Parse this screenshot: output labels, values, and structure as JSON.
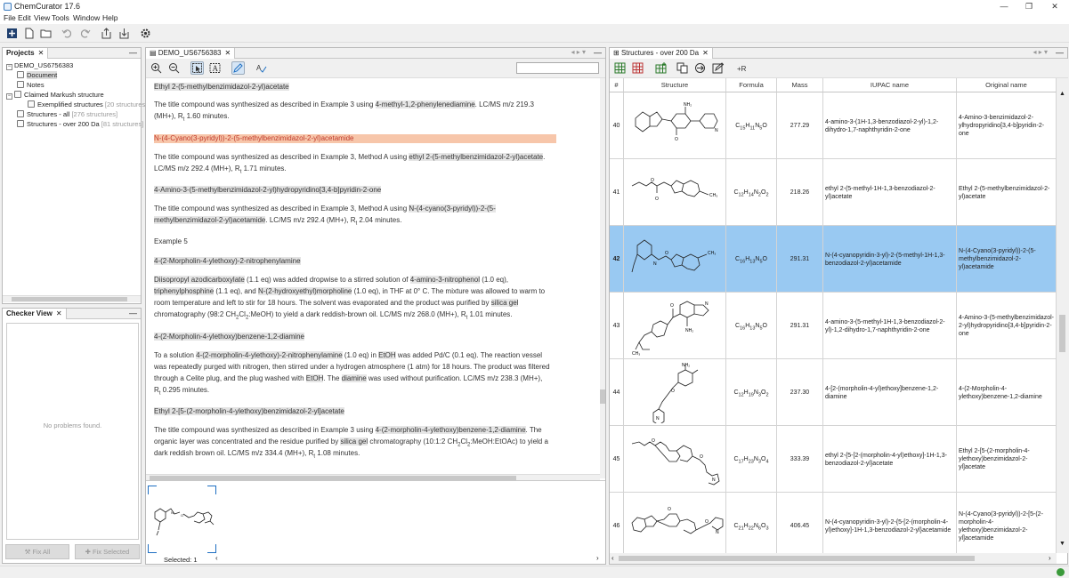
{
  "window": {
    "title": "ChemCurator 17.6"
  },
  "menu": [
    "File",
    "Edit",
    "View",
    "Tools",
    "Window",
    "Help"
  ],
  "projects": {
    "tab": "Projects",
    "tree": [
      {
        "label": "DEMO_US6756383",
        "count": ""
      },
      {
        "label": "Document",
        "count": ""
      },
      {
        "label": "Notes",
        "count": ""
      },
      {
        "label": "Claimed Markush structure",
        "count": ""
      },
      {
        "label": "Exemplified structures",
        "count": "[20 structures]"
      },
      {
        "label": "Structures - all",
        "count": "[276 structures]"
      },
      {
        "label": "Structures - over 200 Da",
        "count": "[81 structures]"
      }
    ]
  },
  "checker": {
    "tab": "Checker View",
    "empty": "No problems found.",
    "fix_all": "Fix All",
    "fix_selected": "Fix Selected"
  },
  "document": {
    "tab": "DEMO_US6756383",
    "selected": "Selected: 1",
    "lines": [
      {
        "t": "title",
        "s": [
          "Ethyl 2-(5-methylbenzimidazol-2-yl)acetate"
        ]
      },
      {
        "t": "text",
        "s": [
          "The title compound was synthesized as described in Example 3 using ",
          "4-methyl-1,2-phenylenediamine",
          ". LC/MS m/z 219.3"
        ]
      },
      {
        "t": "text",
        "s": [
          "(MH+), R",
          "t",
          " 1.60 minutes."
        ]
      },
      {
        "t": "red",
        "s": [
          "N-(4-Cyano(3-pyridyl))-2-(5-methylbenzimidazol-2-yl)acetamide"
        ]
      },
      {
        "t": "text",
        "s": [
          "The title compound was synthesized as described in Example 3, Method A using ",
          "ethyl 2-(5-methylbenzimidazol-2-yl)acetate",
          "."
        ]
      },
      {
        "t": "text",
        "s": [
          "LC/MS m/z 292.4 (MH+), R",
          "t",
          " 1.71 minutes."
        ]
      },
      {
        "t": "title",
        "s": [
          "4-Amino-3-(5-methylbenzimidazol-2-yl)hydropyridino[3,4-b]pyridin-2-one"
        ]
      },
      {
        "t": "text",
        "s": [
          "The title compound was synthesized as described in Example 3, Method A using ",
          "N-(4-cyano(3-pyridyl))-2-(5-"
        ]
      },
      {
        "t": "text",
        "s": [
          "methylbenzimidazol-2-yl)acetamide",
          ". LC/MS m/z 292.4 (MH+), R",
          "t",
          " 2.04 minutes."
        ]
      },
      {
        "t": "plain",
        "s": [
          "Example 5"
        ]
      },
      {
        "t": "title",
        "s": [
          "4-(2-Morpholin-4-ylethoxy)-2-nitrophenylamine"
        ]
      },
      {
        "t": "text",
        "s": [
          "Diisopropyl azodicarboxylate",
          " (1.1 eq) was added dropwise to a stirred solution of ",
          "4-amino-3-nitrophenol",
          " (1.0 eq),"
        ]
      },
      {
        "t": "text",
        "s": [
          "triphenylphosphine",
          " (1.1 eq), and ",
          "N-(2-hydroxyethyl)morpholine",
          " (1.0 eq), in THF at 0° C. The mixture was allowed to warm to"
        ]
      },
      {
        "t": "text",
        "s": [
          "room temperature and left to stir for 18 hours. The solvent was evaporated and the product was purified by ",
          "silica gel",
          ""
        ]
      },
      {
        "t": "text",
        "s": [
          "chromatography (98:2 CH",
          "2",
          "Cl",
          "2",
          ":MeOH) to yield a dark reddish-brown oil. LC/MS m/z 268.0 (MH+), R",
          "t",
          " 1.01 minutes."
        ]
      },
      {
        "t": "title",
        "s": [
          "4-(2-Morpholin-4-ylethoxy)benzene-1,2-diamine"
        ]
      },
      {
        "t": "text",
        "s": [
          "To a solution ",
          "4-(2-morpholin-4-ylethoxy)-2-nitrophenylamine",
          " (1.0 eq) in ",
          "EtOH",
          " was added Pd/C (0.1 eq). The reaction vessel"
        ]
      },
      {
        "t": "text",
        "s": [
          "was repeatedly purged with nitrogen, then stirred under a hydrogen atmosphere (1 atm) for 18 hours. The product was filtered"
        ]
      },
      {
        "t": "text",
        "s": [
          "through a Celite plug, and the plug washed with ",
          "EtOH",
          ". The ",
          "diamine",
          " was used without purification. LC/MS m/z 238.3 (MH+),"
        ]
      },
      {
        "t": "text",
        "s": [
          "R",
          "t",
          " 0.295 minutes."
        ]
      },
      {
        "t": "title",
        "s": [
          "Ethyl 2-[5-(2-morpholin-4-ylethoxy)benzimidazol-2-yl]acetate"
        ]
      },
      {
        "t": "text",
        "s": [
          "The title compound was synthesized as described in Example 3 using ",
          "4-(2-morpholin-4-ylethoxy)benzene-1,2-diamine",
          ". The"
        ]
      },
      {
        "t": "text",
        "s": [
          "organic layer was concentrated and the residue purified by ",
          "silica gel",
          " chromatography (10:1:2 CH",
          "2",
          "Cl",
          "2",
          ":MeOH:EtOAc) to yield a"
        ]
      },
      {
        "t": "text",
        "s": [
          "dark reddish brown oil. LC/MS m/z 334.4 (MH+), R",
          "t",
          " 1.08 minutes."
        ]
      }
    ]
  },
  "table": {
    "tab": "Structures - over 200 Da",
    "headers": [
      "#",
      "Structure",
      "Formula",
      "Mass",
      "IUPAC name",
      "Original name"
    ],
    "rows": [
      {
        "n": "40",
        "formula": "C15H11N5O",
        "mass": "277.29",
        "iupac": "4-amino-3-(1H-1,3-benzodiazol-2-yl)-1,2-dihydro-1,7-naphthyridin-2-one",
        "orig": "4-Amino-3-benzimidazol-2-ylhydropyridino[3,4-b]pyridin-2-one",
        "selected": false
      },
      {
        "n": "41",
        "formula": "C12H14N2O2",
        "mass": "218.26",
        "iupac": "ethyl 2-(5-methyl-1H-1,3-benzodiazol-2-yl)acetate",
        "orig": "Ethyl 2-(5-methylbenzimidazol-2-yl)acetate",
        "selected": false
      },
      {
        "n": "42",
        "formula": "C16H13N5O",
        "mass": "291.31",
        "iupac": "N-(4-cyanopyridin-3-yl)-2-(5-methyl-1H-1,3-benzodiazol-2-yl)acetamide",
        "orig": "N-(4-Cyano(3-pyridyl))-2-(5-methylbenzimidazol-2-yl)acetamide",
        "selected": true
      },
      {
        "n": "43",
        "formula": "C16H13N5O",
        "mass": "291.31",
        "iupac": "4-amino-3-(5-methyl-1H-1,3-benzodiazol-2-yl)-1,2-dihydro-1,7-naphthyridin-2-one",
        "orig": "4-Amino-3-(5-methylbenzimidazol-2-yl)hydropyridino[3,4-b]pyridin-2-one",
        "selected": false
      },
      {
        "n": "44",
        "formula": "C12H19N3O2",
        "mass": "237.30",
        "iupac": "4-[2-(morpholin-4-yl)ethoxy]benzene-1,2-diamine",
        "orig": "4-(2-Morpholin-4-ylethoxy)benzene-1,2-diamine",
        "selected": false
      },
      {
        "n": "45",
        "formula": "C17H23N3O4",
        "mass": "333.39",
        "iupac": "ethyl 2-{5-[2-(morpholin-4-yl)ethoxy]-1H-1,3-benzodiazol-2-yl}acetate",
        "orig": "Ethyl 2-[5-(2-morpholin-4-ylethoxy)benzimidazol-2-yl]acetate",
        "selected": false
      },
      {
        "n": "46",
        "formula": "C21H22N6O3",
        "mass": "406.45",
        "iupac": "N-(4-cyanopyridin-3-yl)-2-{5-[2-(morpholin-4-yl)ethoxy]-1H-1,3-benzodiazol-2-yl}acetamide",
        "orig": "N-(4-Cyano(3-pyridyl))-2-[5-(2-morpholin-4-ylethoxy)benzimidazol-2-yl]acetamide",
        "selected": false
      }
    ]
  },
  "colors": {
    "selection": "#99c9f2",
    "highlight_red": "#f7c6aa",
    "accent": "#1e6fc2"
  }
}
